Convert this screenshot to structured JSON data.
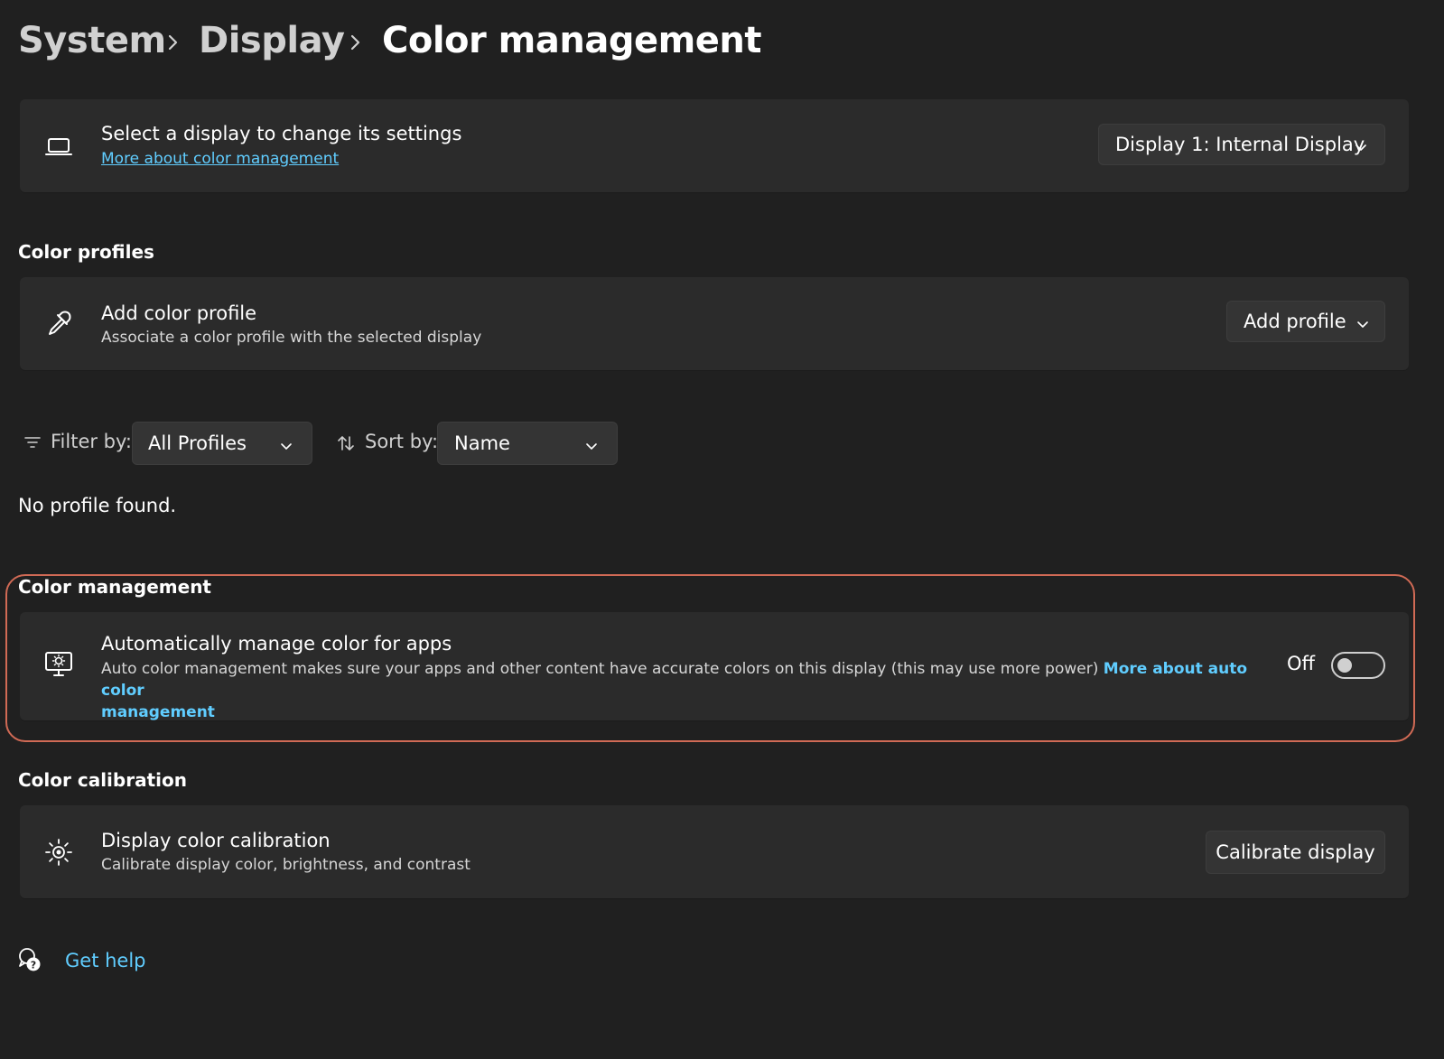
{
  "breadcrumb": {
    "items": [
      "System",
      "Display",
      "Color management"
    ]
  },
  "display_select": {
    "title": "Select a display to change its settings",
    "link": "More about color management",
    "dropdown_value": "Display 1: Internal Display",
    "icon": "laptop-icon"
  },
  "color_profiles": {
    "section_title": "Color profiles",
    "card_title": "Add color profile",
    "card_sub": "Associate a color profile with the selected display",
    "button_label": "Add profile",
    "icon": "eyedropper-icon"
  },
  "filters": {
    "filter_label": "Filter by:",
    "filter_value": "All Profiles",
    "sort_label": "Sort by:",
    "sort_value": "Name"
  },
  "empty_message": "No profile found.",
  "color_management": {
    "section_title": "Color management",
    "card_title": "Automatically manage color for apps",
    "card_sub": "Auto color management makes sure your apps and other content have accurate colors on this display (this may use more power)",
    "link_line1": "More about auto color",
    "link_line2": "management",
    "toggle_state": "Off",
    "toggle_on": false,
    "icon": "monitor-brightness-icon"
  },
  "color_calibration": {
    "section_title": "Color calibration",
    "card_title": "Display color calibration",
    "card_sub": "Calibrate display color, brightness, and contrast",
    "button_label": "Calibrate display",
    "icon": "brightness-icon"
  },
  "help": {
    "label": "Get help",
    "icon": "help-chat-icon"
  },
  "colors": {
    "background": "#202020",
    "card": "#2b2b2b",
    "accent_link": "#60cdff",
    "highlight_border": "#d06a55"
  }
}
